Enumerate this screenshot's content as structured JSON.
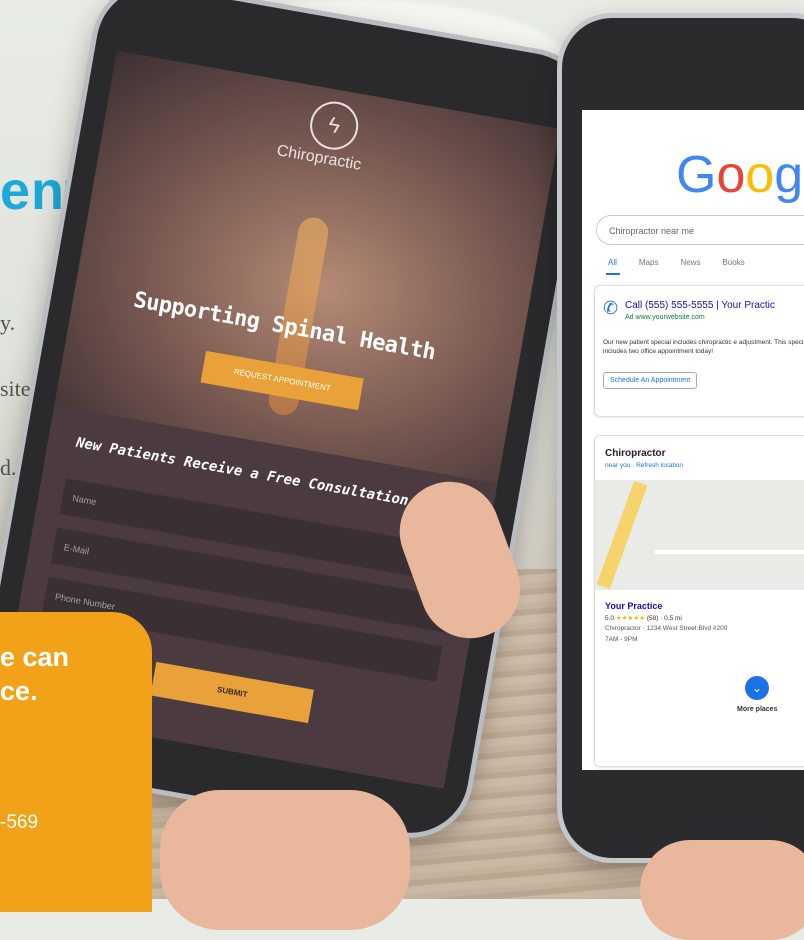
{
  "left_panel": {
    "heading_fragment": "ents",
    "body_fragments": [
      "y.",
      "site",
      "d."
    ],
    "promo": {
      "line1": "e can",
      "line2": "ce.",
      "phone_fragment": "-569"
    }
  },
  "phone_left": {
    "brand": "Chiropractic",
    "hero_title": "Supporting Spinal Health",
    "cta_label": "REQUEST APPOINTMENT",
    "form_title": "New Patients Receive a Free Consultation.",
    "fields": [
      {
        "placeholder": "Name"
      },
      {
        "placeholder": "E-Mail"
      },
      {
        "placeholder": "Phone Number"
      }
    ],
    "submit_label": "SUBMIT"
  },
  "phone_right": {
    "logo_letters": [
      "G",
      "o",
      "o",
      "g"
    ],
    "search_query": "Chiropractor near me",
    "tabs": [
      "All",
      "Maps",
      "News",
      "Books"
    ],
    "active_tab": "All",
    "ad": {
      "call_text": "Call (555) 555-5555 | Your Practic",
      "site_text": "Ad  www.yourwebsite.com",
      "description": "Our new patient special includes chiropractic e adjustment. This special offer includes two office appointment today!",
      "button_label": "Schedule An Appointment"
    },
    "local": {
      "title": "Chiropractor",
      "subtitle": "near you · Refresh location",
      "business_name": "Your Practice",
      "rating": "5.0",
      "stars": "★★★★★",
      "reviews": "(58) · 0.5 mi",
      "address": "Chiropractor · 1234 West Street Blvd #200",
      "hours": "7AM - 9PM",
      "more_label": "More places"
    }
  }
}
